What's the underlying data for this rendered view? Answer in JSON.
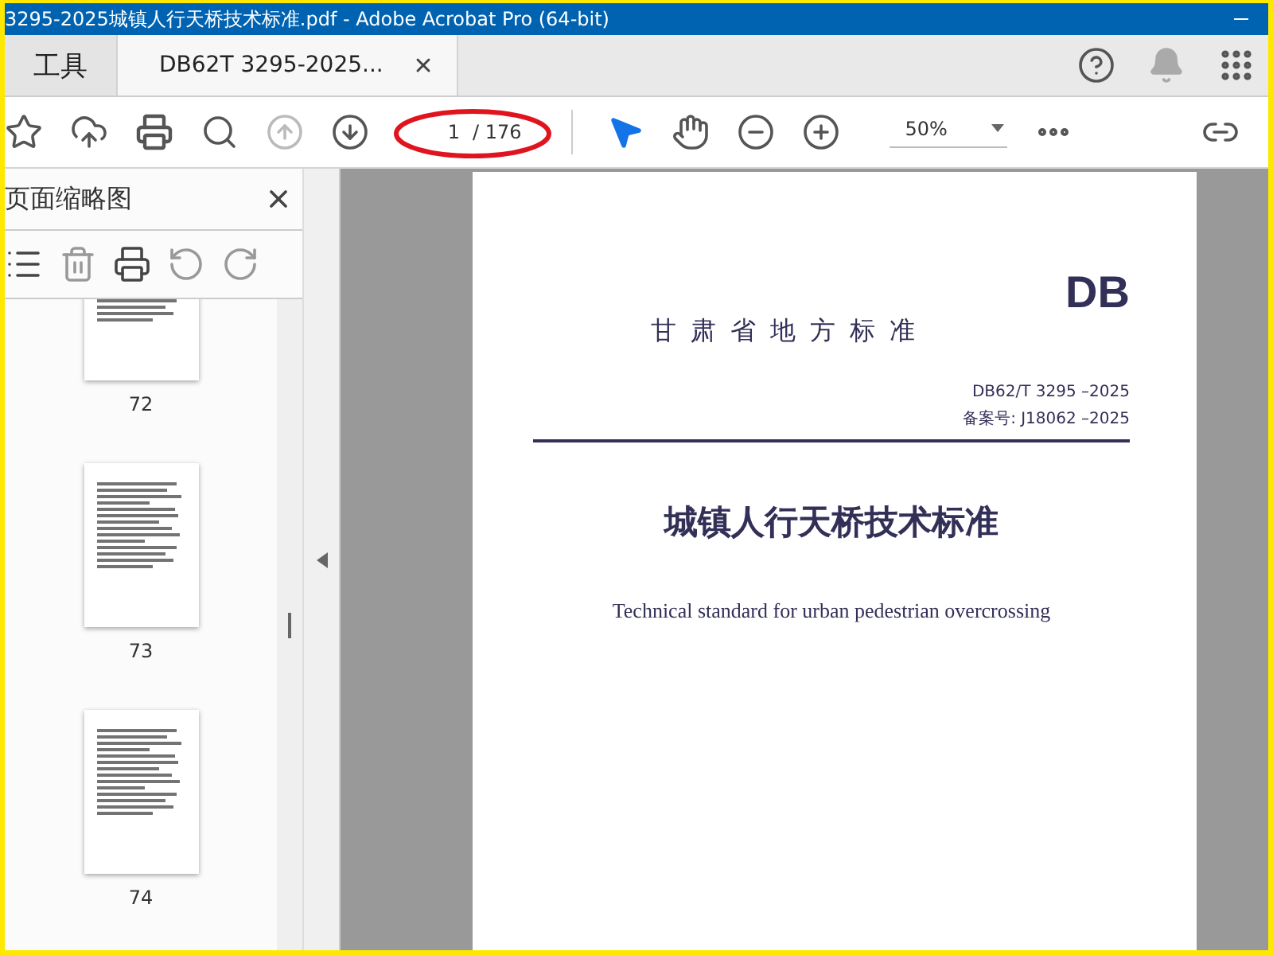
{
  "window": {
    "title": "3295-2025城镇人行天桥技术标准.pdf - Adobe Acrobat Pro (64-bit)"
  },
  "tabs": [
    {
      "label": "工具",
      "selected": false,
      "closable": false
    },
    {
      "label": "DB62T 3295-2025...",
      "selected": true,
      "closable": true
    }
  ],
  "toolbar": {
    "page_current": "1",
    "page_total": "/ 176",
    "zoom": "50%"
  },
  "thumbnails_panel": {
    "title": "页面缩略图",
    "pages": [
      {
        "label": "72"
      },
      {
        "label": "73"
      },
      {
        "label": "74"
      }
    ]
  },
  "document": {
    "badge": "DB",
    "authority": "甘肃省地方标准",
    "code": "DB62/T 3295 –2025",
    "record_number": "备案号: J18062 –2025",
    "title": "城镇人行天桥技术标准",
    "english_title": "Technical standard for urban pedestrian overcrossing"
  }
}
